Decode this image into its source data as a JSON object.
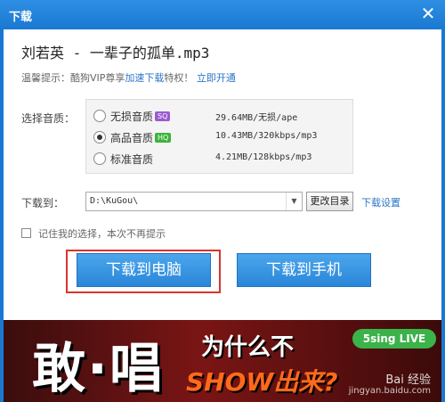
{
  "window": {
    "title": "下载",
    "close_glyph": "✕"
  },
  "song": {
    "title": "刘若英 - 一辈子的孤单.mp3"
  },
  "tip": {
    "prefix": "温馨提示：酷狗VIP尊享",
    "link1": "加速下载",
    "middle": "特权！",
    "link2": "立即开通"
  },
  "quality": {
    "label": "选择音质：",
    "options": [
      {
        "name": "无损音质",
        "badge": "SQ",
        "info": "29.64MB/无损/ape",
        "selected": false
      },
      {
        "name": "高品音质",
        "badge": "HQ",
        "info": "10.43MB/320kbps/mp3",
        "selected": true
      },
      {
        "name": "标准音质",
        "badge": "",
        "info": "4.21MB/128kbps/mp3",
        "selected": false
      }
    ]
  },
  "download_to": {
    "label": "下载到：",
    "path": "D:\\KuGou\\",
    "change_button": "更改目录",
    "settings_link": "下载设置"
  },
  "remember": {
    "label": "记住我的选择，本次不再提示",
    "checked": false
  },
  "buttons": {
    "to_pc": "下载到电脑",
    "to_phone": "下载到手机"
  },
  "banner": {
    "main_text": "敢·唱",
    "question": "为什么不",
    "show_text": "SHOW出来?",
    "brand": "5sing LIVE",
    "watermark_logo": "Bai 经验",
    "watermark_url": "jingyan.baidu.com"
  },
  "colors": {
    "titlebar": "#1a78d2",
    "button": "#2a86d8",
    "highlight": "#d9342b",
    "link": "#2a76c8"
  }
}
